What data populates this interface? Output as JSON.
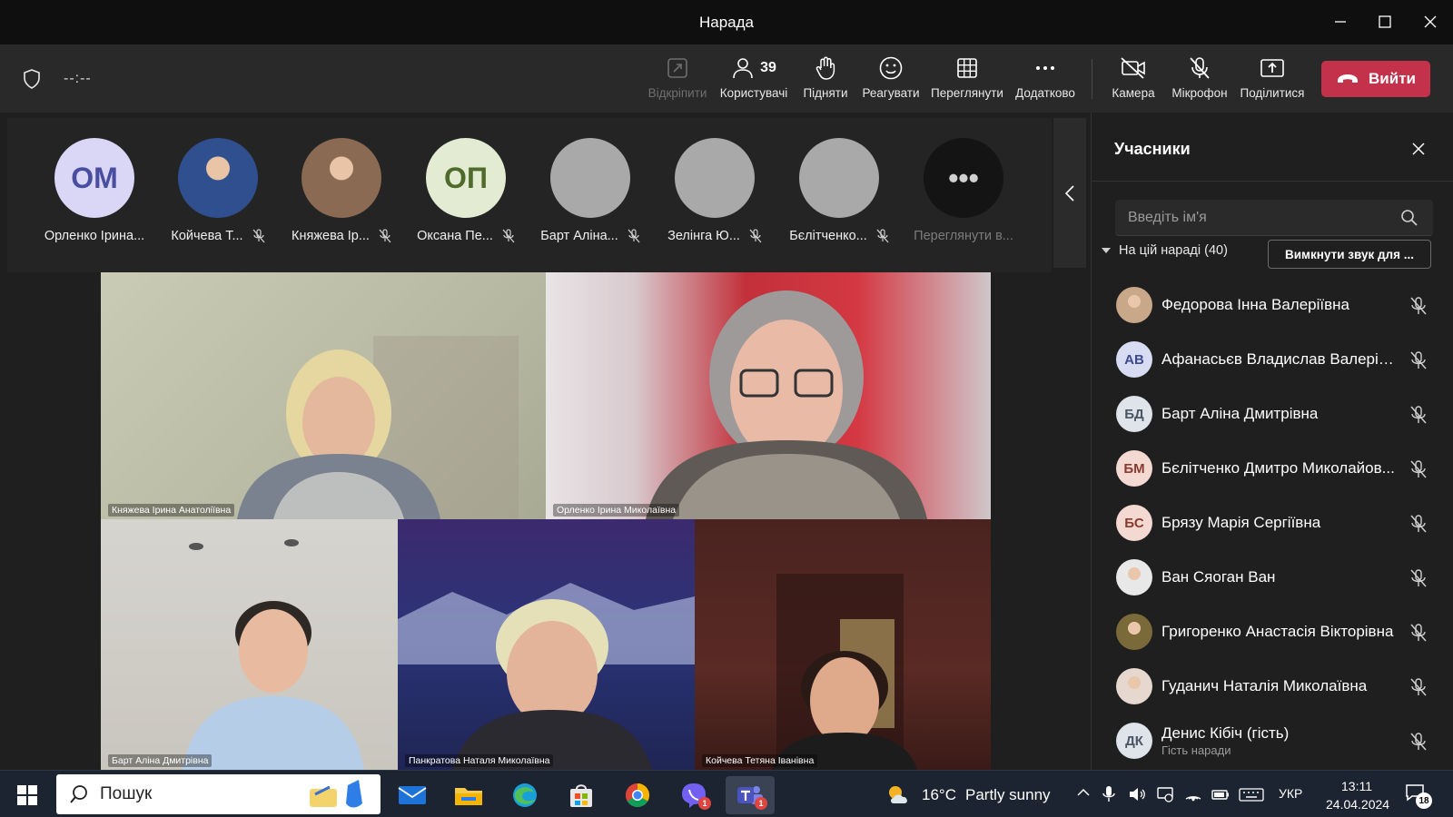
{
  "window": {
    "title": "Нарада"
  },
  "toolbar": {
    "timer": "--:--",
    "buttons": [
      {
        "label": "Відкріпити",
        "icon": "unpin-icon",
        "disabled": true
      },
      {
        "label": "Користувачі",
        "icon": "people-icon",
        "count": "39",
        "active": true
      },
      {
        "label": "Підняти",
        "icon": "raise-hand-icon"
      },
      {
        "label": "Реагувати",
        "icon": "react-icon"
      },
      {
        "label": "Переглянути",
        "icon": "view-grid-icon"
      },
      {
        "label": "Додатково",
        "icon": "more-icon"
      },
      {
        "label": "Камера",
        "icon": "camera-off-icon"
      },
      {
        "label": "Мікрофон",
        "icon": "mic-off-icon"
      },
      {
        "label": "Поділитися",
        "icon": "share-icon"
      }
    ],
    "leave_label": "Вийти"
  },
  "gallery": [
    {
      "name": "Орленко Ірина...",
      "initials": "ОМ",
      "avatar_color": "#d9d6f6",
      "text_color": "#4a4ea0",
      "muted": false
    },
    {
      "name": "Койчева Т...",
      "initials": "",
      "avatar_color": "#2f4f8f",
      "photo": true,
      "muted": true
    },
    {
      "name": "Княжева Ір...",
      "initials": "",
      "avatar_color": "#8a6a52",
      "photo": true,
      "muted": true
    },
    {
      "name": "Оксана Пе...",
      "initials": "ОП",
      "avatar_color": "#e3ecd3",
      "text_color": "#4f6b2c",
      "muted": true
    },
    {
      "name": "Барт Аліна...",
      "initials": "",
      "avatar_color": "#a9a9a9",
      "muted": true
    },
    {
      "name": "Зелінга Ю...",
      "initials": "",
      "avatar_color": "#a9a9a9",
      "muted": true
    },
    {
      "name": "Бєлітченко...",
      "initials": "",
      "avatar_color": "#a9a9a9",
      "muted": true
    },
    {
      "name": "Переглянути в...",
      "initials": "•••",
      "avatar_color": "#141414",
      "text_color": "#d0d0d0",
      "muted": false,
      "dim": true
    }
  ],
  "videos": [
    {
      "name": "Княжева Ірина Анатоліївна"
    },
    {
      "name": "Орленко Ірина Миколаївна"
    },
    {
      "name": "Барт Аліна Дмитрівна"
    },
    {
      "name": "Панкратова Наталя Миколаївна"
    },
    {
      "name": "Койчева Тетяна Іванівна"
    }
  ],
  "panel": {
    "title": "Учасники",
    "search_placeholder": "Введіть ім'я",
    "section_label": "На цій нараді (40)",
    "mute_all_label": "Вимкнути звук для ...",
    "participants": [
      {
        "name": "Федорова Інна Валеріївна",
        "initials": "",
        "photo": true,
        "avatar_color": "#c9a88a",
        "subtitle": ""
      },
      {
        "name": "Афанасьєв Владислав Валерійо...",
        "initials": "АВ",
        "avatar_color": "#d7dcf3",
        "text_color": "#3c4b8c",
        "subtitle": ""
      },
      {
        "name": "Барт Аліна Дмитрівна",
        "initials": "БД",
        "avatar_color": "#dfe3ea",
        "text_color": "#4b5563",
        "subtitle": ""
      },
      {
        "name": "Бєлітченко Дмитро Миколайов...",
        "initials": "БМ",
        "avatar_color": "#f3d9d2",
        "text_color": "#8a3b2e",
        "subtitle": ""
      },
      {
        "name": "Брязу Марія Сергіївна",
        "initials": "БС",
        "avatar_color": "#f3d9d2",
        "text_color": "#8a3b2e",
        "subtitle": ""
      },
      {
        "name": "Ван Сяоган Ван",
        "initials": "",
        "photo": true,
        "avatar_color": "#e8e8e8",
        "subtitle": ""
      },
      {
        "name": "Григоренко Анастасія Вікторівна",
        "initials": "",
        "photo": true,
        "avatar_color": "#7a6a3a",
        "subtitle": ""
      },
      {
        "name": "Гуданич Наталія Миколаївна",
        "initials": "",
        "photo": true,
        "avatar_color": "#e6d8cf",
        "subtitle": ""
      },
      {
        "name": "Денис Кібіч (гість)",
        "initials": "ДК",
        "avatar_color": "#dfe3ea",
        "text_color": "#4b5563",
        "subtitle": "Гість наради"
      }
    ]
  },
  "taskbar": {
    "search_text": "Пошук",
    "weather": {
      "temp": "16°C",
      "desc": "Partly sunny"
    },
    "language": "УКР",
    "time": "13:11",
    "date": "24.04.2024",
    "notifications": "18",
    "apps": [
      {
        "icon": "mail-icon",
        "badge": ""
      },
      {
        "icon": "file-explorer-icon",
        "badge": ""
      },
      {
        "icon": "edge-icon",
        "badge": ""
      },
      {
        "icon": "store-icon",
        "badge": ""
      },
      {
        "icon": "chrome-icon",
        "badge": ""
      },
      {
        "icon": "viber-icon",
        "badge": "1"
      },
      {
        "icon": "teams-icon",
        "badge": "1",
        "active": true
      }
    ]
  }
}
